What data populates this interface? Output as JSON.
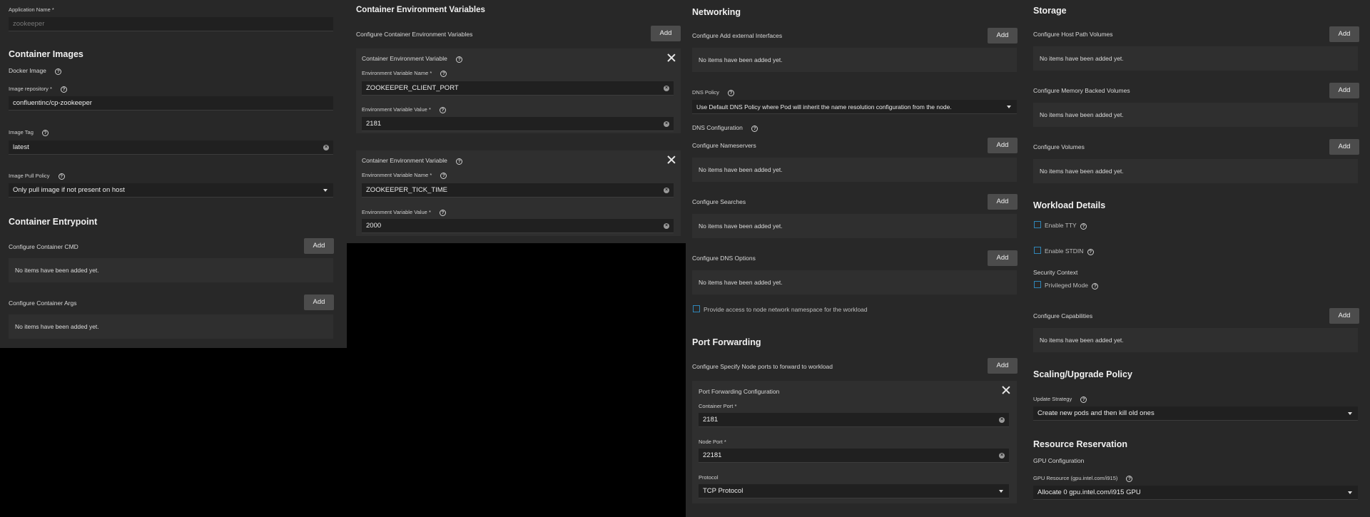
{
  "col1": {
    "app_name_label": "Application Name *",
    "app_name_value": "zookeeper",
    "images_title": "Container Images",
    "docker_image_label": "Docker Image",
    "repo_label": "Image repository *",
    "repo_value": "confluentinc/cp-zookeeper",
    "tag_label": "Image Tag",
    "tag_value": "latest",
    "pull_label": "Image Pull Policy",
    "pull_value": "Only pull image if not present on host",
    "entry_title": "Container Entrypoint",
    "cmd_label": "Configure Container CMD",
    "args_label": "Configure Container Args"
  },
  "col2": {
    "title": "Container Environment Variables",
    "configure_label": "Configure Container Environment Variables",
    "vars": [
      {
        "card_title": "Container Environment Variable",
        "name_label": "Environment Variable Name *",
        "name_value": "ZOOKEEPER_CLIENT_PORT",
        "value_label": "Environment Variable Value *",
        "value_value": "2181"
      },
      {
        "card_title": "Container Environment Variable",
        "name_label": "Environment Variable Name *",
        "name_value": "ZOOKEEPER_TICK_TIME",
        "value_label": "Environment Variable Value *",
        "value_value": "2000"
      }
    ]
  },
  "col3": {
    "net_title": "Networking",
    "ext_label": "Configure Add external Interfaces",
    "dns_policy_label": "DNS Policy",
    "dns_policy_value": "Use Default DNS Policy where Pod will inherit the name resolution configuration from the node.",
    "dns_config_label": "DNS Configuration",
    "nameservers_label": "Configure Nameservers",
    "searches_label": "Configure Searches",
    "dns_options_label": "Configure DNS Options",
    "host_net_label": "Provide access to node network namespace for the workload",
    "pf_title": "Port Forwarding",
    "pf_label": "Configure Specify Node ports to forward to workload",
    "pf_card_title": "Port Forwarding Configuration",
    "container_port_label": "Container Port *",
    "container_port_value": "2181",
    "node_port_label": "Node Port *",
    "node_port_value": "22181",
    "protocol_label": "Protocol",
    "protocol_value": "TCP Protocol"
  },
  "col4": {
    "storage_title": "Storage",
    "hostpath_label": "Configure Host Path Volumes",
    "memory_label": "Configure Memory Backed Volumes",
    "volumes_label": "Configure Volumes",
    "workload_title": "Workload Details",
    "tty_label": "Enable TTY",
    "stdin_label": "Enable STDIN",
    "sec_ctx_label": "Security Context",
    "priv_label": "Privileged Mode",
    "caps_label": "Configure Capabilities",
    "scaling_title": "Scaling/Upgrade Policy",
    "strategy_label": "Update Strategy",
    "strategy_value": "Create new pods and then kill old ones",
    "resource_title": "Resource Reservation",
    "gpu_config_label": "GPU Configuration",
    "gpu_resource_label": "GPU Resource (gpu.intel.com/i915)",
    "gpu_resource_value": "Allocate 0 gpu.intel.com/i915 GPU"
  },
  "common": {
    "add_label": "Add",
    "empty_text": "No items have been added yet.",
    "help_glyph": "?"
  }
}
